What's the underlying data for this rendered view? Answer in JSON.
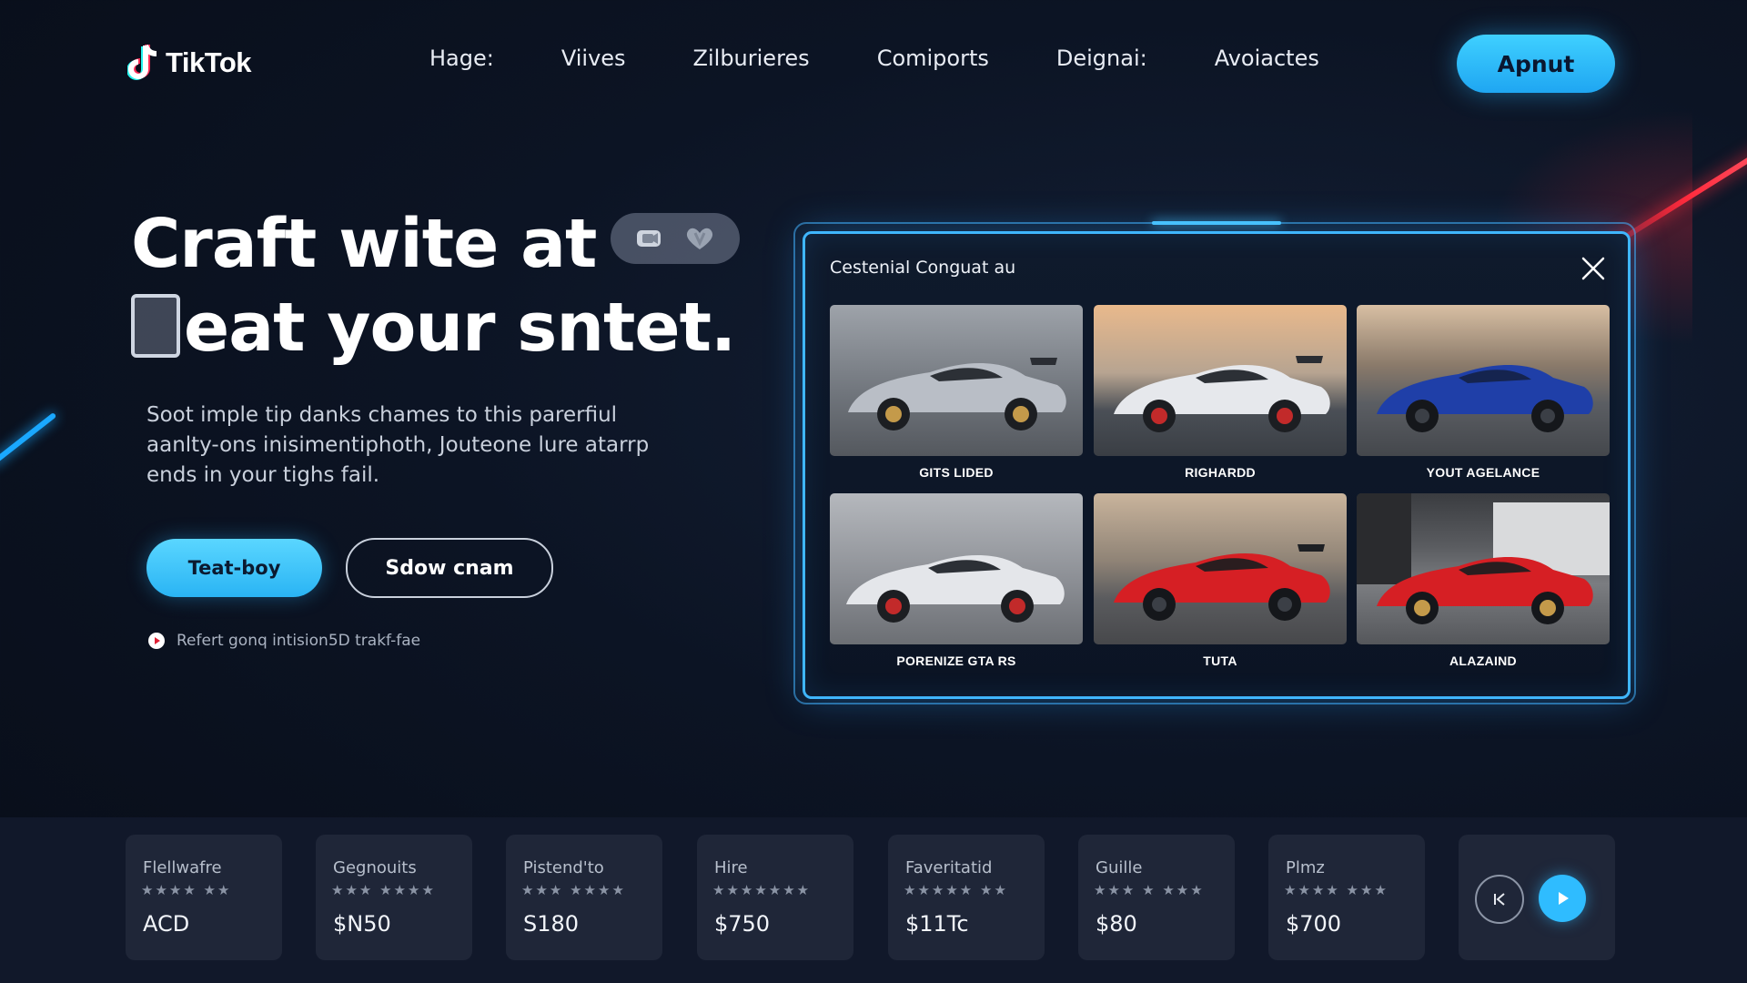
{
  "header": {
    "logo_text": "TikTok",
    "nav": [
      "Hage:",
      "Viives",
      "Zilburieres",
      "Comiports",
      "Deignai:",
      "Avoiactes"
    ],
    "cta_label": "Apnut"
  },
  "hero": {
    "title_line1": "Craft wite at",
    "title_line2": "eat your sntet.",
    "description": "Soot imple tip danks chames to this parerfiul aanlty-ons inisimentiphoth, Jouteone lure atarrp ends in your tighs fail.",
    "primary_button": "Teat-boy",
    "secondary_button": "Sdow cnam",
    "hint": "Refert gonq intision5D trakf-fae"
  },
  "modal": {
    "title": "Cestenial Conguat au",
    "cards": [
      {
        "label": "GITS LIDED",
        "color": "#b9bec6"
      },
      {
        "label": "RIGHARDD",
        "color": "#e6e8ec"
      },
      {
        "label": "YOUT AGELANCE",
        "color": "#1f3fa8"
      },
      {
        "label": "PORENIZE GTA RS",
        "color": "#e4e6ea"
      },
      {
        "label": "TUTA",
        "color": "#d61f24"
      },
      {
        "label": "ALAZAIND",
        "color": "#d61f24"
      }
    ]
  },
  "tiles": [
    {
      "name": "Flellwafre",
      "stars": "★★★★ ★★",
      "price": "ACD"
    },
    {
      "name": "Gegnouits",
      "stars": "★★★ ★★★★",
      "price": "$N50"
    },
    {
      "name": "Pistend'to",
      "stars": "★★★ ★★★★",
      "price": "S180"
    },
    {
      "name": "Hire",
      "stars": "★★★★★★★",
      "price": "$750"
    },
    {
      "name": "Faveritatid",
      "stars": "★★★★★ ★★",
      "price": "$11Tc"
    },
    {
      "name": "Guille",
      "stars": "★★★ ★ ★★★",
      "price": "$80"
    },
    {
      "name": "Plmz",
      "stars": "★★★★ ★★★",
      "price": "$700"
    }
  ],
  "colors": {
    "accent": "#2fbcff",
    "background": "#0c1424",
    "streak_red": "#ff2a3c"
  }
}
